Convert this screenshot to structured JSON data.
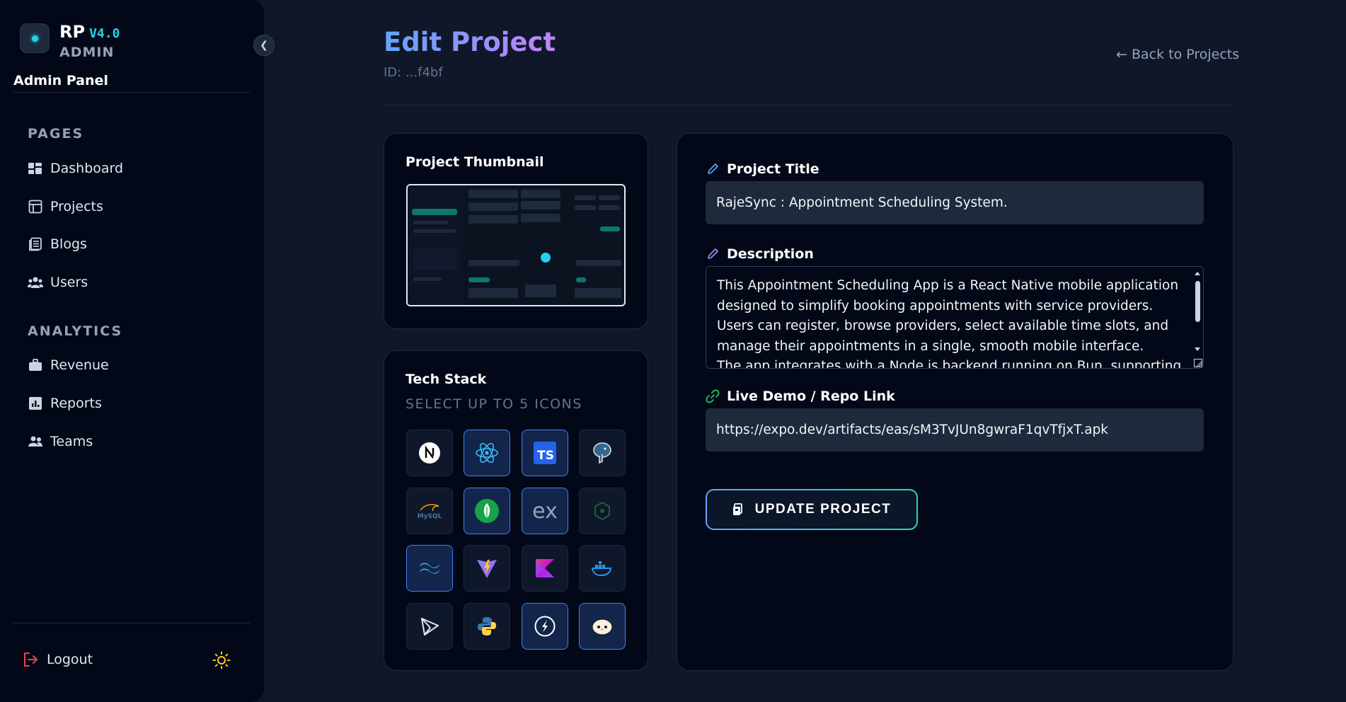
{
  "sidebar": {
    "brand": {
      "name": "RP",
      "version": "V4.0",
      "role": "ADMIN"
    },
    "panel_label": "Admin Panel",
    "sections": [
      {
        "title": "PAGES",
        "items": [
          {
            "label": "Dashboard",
            "icon": "dashboard-icon"
          },
          {
            "label": "Projects",
            "icon": "projects-icon"
          },
          {
            "label": "Blogs",
            "icon": "blogs-icon"
          },
          {
            "label": "Users",
            "icon": "users-icon"
          }
        ]
      },
      {
        "title": "ANALYTICS",
        "items": [
          {
            "label": "Revenue",
            "icon": "briefcase-icon"
          },
          {
            "label": "Reports",
            "icon": "reports-icon"
          },
          {
            "label": "Teams",
            "icon": "teams-icon"
          }
        ]
      }
    ],
    "logout_label": "Logout",
    "theme_icon": "sun-icon"
  },
  "header": {
    "title": "Edit Project",
    "id_text": "ID: ...f4bf",
    "back_link": "← Back to Projects"
  },
  "thumbnail_card": {
    "title": "Project Thumbnail"
  },
  "tech_stack": {
    "title": "Tech Stack",
    "subtitle": "SELECT UP TO 5 ICONS",
    "icons": [
      {
        "name": "nextjs",
        "selected": false
      },
      {
        "name": "react",
        "selected": true
      },
      {
        "name": "typescript",
        "selected": true
      },
      {
        "name": "postgresql",
        "selected": false
      },
      {
        "name": "mysql",
        "selected": false
      },
      {
        "name": "mongodb",
        "selected": true
      },
      {
        "name": "express",
        "selected": true
      },
      {
        "name": "nodejs",
        "selected": false
      },
      {
        "name": "tailwindcss",
        "selected": true
      },
      {
        "name": "vite",
        "selected": false
      },
      {
        "name": "kotlin",
        "selected": false
      },
      {
        "name": "docker",
        "selected": false
      },
      {
        "name": "prisma",
        "selected": false
      },
      {
        "name": "python",
        "selected": false
      },
      {
        "name": "socketio",
        "selected": true
      },
      {
        "name": "bun",
        "selected": true
      }
    ],
    "labels": {
      "typescript": "TS",
      "express": "ex",
      "mysql": "MySQL"
    }
  },
  "form": {
    "title_label": "Project Title",
    "title_value": "RajeSync : Appointment Scheduling System.",
    "description_label": "Description",
    "description_value": "This Appointment Scheduling App is a React Native mobile application designed to simplify booking appointments with service providers. Users can register, browse providers, select available time slots, and manage their appointments in a single, smooth mobile interface.\nThe app integrates with a Node.js backend running on Bun, supporting",
    "link_label": "Live Demo / Repo Link",
    "link_value": "https://expo.dev/artifacts/eas/sM3TvJUn8gwraF1qvTfjxT.apk",
    "submit_label": "UPDATE PROJECT"
  },
  "colors": {
    "background": "#0f1729",
    "sidebar": "#020817",
    "accent_blue": "#3b82f6",
    "accent_cyan": "#22d3ee",
    "title_gradient_start": "#60a5fa",
    "title_gradient_end": "#c084fc"
  }
}
